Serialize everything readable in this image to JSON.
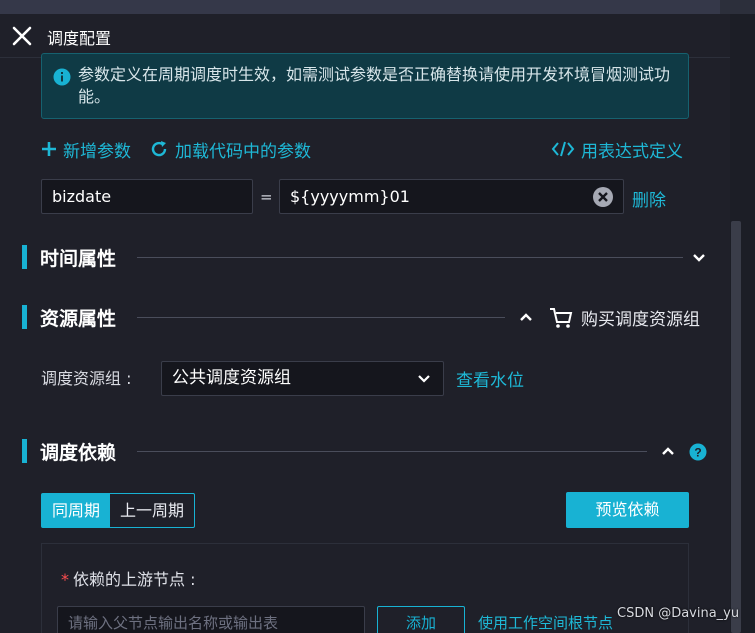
{
  "window": {
    "title": "调度配置",
    "close_icon": "close-icon"
  },
  "info_banner": {
    "icon": "info-icon",
    "text": "参数定义在周期调度时生效，如需测试参数是否正确替换请使用开发环境冒烟测试功能。"
  },
  "param_actions": {
    "add_label": "新增参数",
    "load_label": "加载代码中的参数",
    "expr_label": "用表达式定义"
  },
  "param_row": {
    "key": "bizdate",
    "equals": "=",
    "value": "${yyyymm}01",
    "delete_label": "删除"
  },
  "sections": {
    "time": {
      "title": "时间属性",
      "expanded": false
    },
    "resource": {
      "title": "资源属性",
      "expanded": true,
      "buy_label": "购买调度资源组"
    },
    "dependency": {
      "title": "调度依赖",
      "expanded": true
    }
  },
  "resource_group": {
    "label": "调度资源组 :",
    "selected": "公共调度资源组",
    "watermark_link": "查看水位"
  },
  "dependency": {
    "tabs": [
      {
        "label": "同周期",
        "active": true
      },
      {
        "label": "上一周期",
        "active": false
      }
    ],
    "preview_label": "预览依赖",
    "upstream_label": "依赖的上游节点 :",
    "required_mark": "*",
    "input_placeholder": "请输入父节点输出名称或输出表",
    "add_label": "添加",
    "auto_parse_label": "使用工作空间根节点"
  },
  "watermark": "CSDN @Davina_yu",
  "colors": {
    "accent": "#18b2d3",
    "background": "#1f2029",
    "info_bg": "#0f3a45"
  }
}
